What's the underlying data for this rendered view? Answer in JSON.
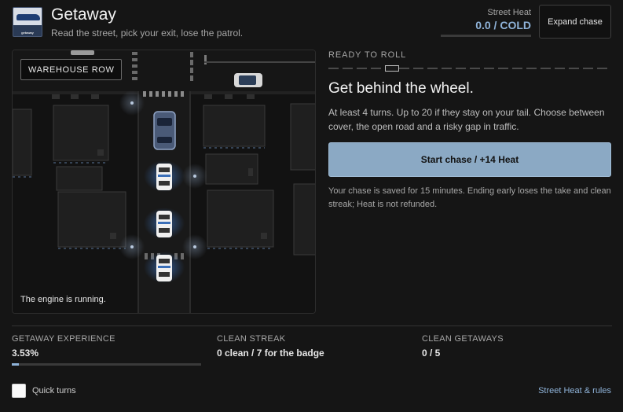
{
  "header": {
    "logo_text": "getaway",
    "title": "Getaway",
    "subtitle": "Read the street, pick your exit, lose the patrol.",
    "heat_label": "Street Heat",
    "heat_value": "0.0 / COLD",
    "heat_level": 0,
    "expand_label": "Expand chase"
  },
  "map": {
    "district": "WAREHOUSE ROW",
    "status": "The engine is running."
  },
  "chase": {
    "ready_label": "READY TO ROLL",
    "progress_steps": 20,
    "current_step": 5,
    "headline": "Get behind the wheel.",
    "description": "At least 4 turns. Up to 20 if they stay on your tail. Choose between cover, the open road and a risky gap in traffic.",
    "start_label": "Start chase / +14 Heat",
    "note": "Your chase is saved for 15 minutes. Ending early loses the take and clean streak; Heat is not refunded."
  },
  "stats": {
    "experience_label": "GETAWAY EXPERIENCE",
    "experience_value": "3.53%",
    "experience_fraction": 0.0353,
    "streak_label": "CLEAN STREAK",
    "streak_value": "0 clean / 7 for the badge",
    "getaways_label": "CLEAN GETAWAYS",
    "getaways_value": "0 / 5"
  },
  "footer": {
    "quick_turns_label": "Quick turns",
    "quick_turns_checked": false,
    "rules_link": "Street Heat & rules"
  },
  "colors": {
    "background": "#151515",
    "accent": "#8fb3d9",
    "button": "#8ba9c4",
    "police_glow": "#3b6fb8"
  }
}
